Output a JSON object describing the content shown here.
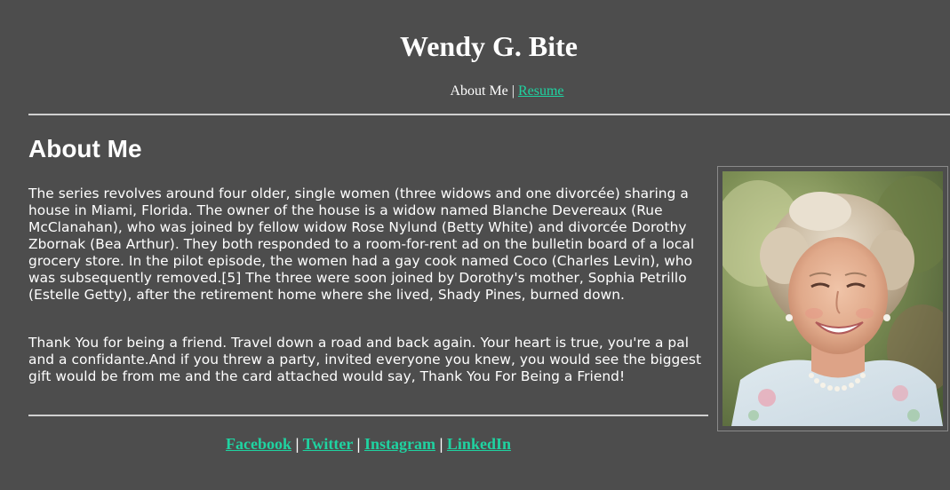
{
  "header": {
    "title": "Wendy G. Bite"
  },
  "nav": {
    "about": "About Me",
    "separator": "|",
    "resume": "Resume"
  },
  "main": {
    "heading": "About Me",
    "paragraphs": [
      "The series revolves around four older, single women (three widows and one divorcée) sharing a house in Miami, Florida. The owner of the house is a widow named Blanche Devereaux (Rue McClanahan), who was joined by fellow widow Rose Nylund (Betty White) and divorcée Dorothy Zbornak (Bea Arthur). They both responded to a room-for-rent ad on the bulletin board of a local grocery store. In the pilot episode, the women had a gay cook named Coco (Charles Levin), who was subsequently removed.[5] The three were soon joined by Dorothy's mother, Sophia Petrillo (Estelle Getty), after the retirement home where she lived, Shady Pines, burned down.",
      "Thank You for being a friend. Travel down a road and back again. Your heart is true, you're a pal and a confidante.And if you threw a party, invited everyone you knew, you would see the biggest gift would be from me and the card attached would say, Thank You For Being a Friend!"
    ]
  },
  "footer": {
    "links": [
      "Facebook",
      "Twitter",
      "Instagram",
      "LinkedIn"
    ],
    "separator": "|"
  },
  "colors": {
    "background": "#4d4d4d",
    "link": "#1fd3a1",
    "text": "#ffffff",
    "rule": "#d0d0d0"
  }
}
